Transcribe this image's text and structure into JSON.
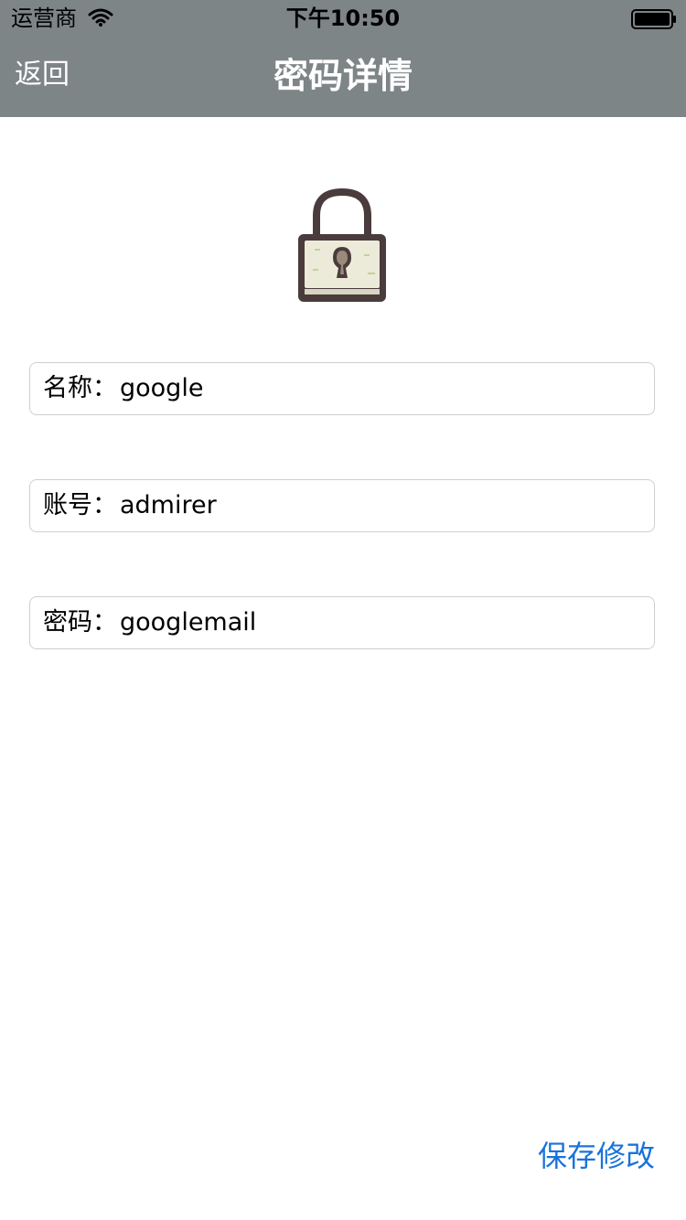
{
  "status_bar": {
    "carrier": "运营商",
    "time": "下午10:50"
  },
  "nav": {
    "back_label": "返回",
    "title": "密码详情"
  },
  "lock": {
    "icon": "padlock-icon"
  },
  "fields": [
    {
      "label": "名称：",
      "value": "google"
    },
    {
      "label": "账号：",
      "value": "admirer"
    },
    {
      "label": "密码：",
      "value": "googlemail"
    }
  ],
  "actions": {
    "save_label": "保存修改"
  },
  "colors": {
    "nav_background": "#7e8587",
    "accent_blue": "#1a73d9",
    "field_border": "#cfcfcf"
  }
}
